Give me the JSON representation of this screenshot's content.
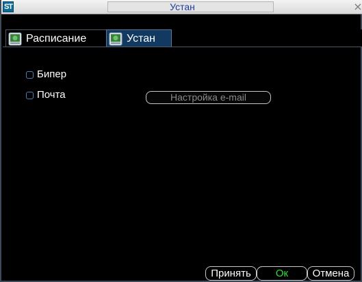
{
  "window": {
    "title": "Устан",
    "logo_text": "ST",
    "close_glyph": "×"
  },
  "tabs": [
    {
      "label": "Расписание",
      "icon": "screen-settings-icon",
      "active": false
    },
    {
      "label": "Устан",
      "icon": "screen-settings-icon",
      "active": true
    }
  ],
  "options": {
    "beeper_label": "Бипер",
    "beeper_checked": false,
    "mail_label": "Почта",
    "mail_checked": false,
    "email_setup_label": "Настройка e-mail"
  },
  "footer": {
    "apply_label": "Принять",
    "ok_label": "Ок",
    "cancel_label": "Отмена"
  },
  "colors": {
    "title_text": "#1e3c96",
    "active_tab": "#123a60",
    "ok_text": "#30e030",
    "checkbox_border": "#4a7db8"
  }
}
